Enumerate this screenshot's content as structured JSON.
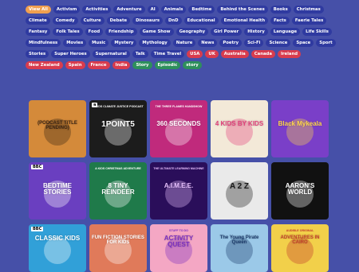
{
  "tags": [
    {
      "label": "View All",
      "style": "active"
    },
    {
      "label": "Activism"
    },
    {
      "label": "Activities"
    },
    {
      "label": "Adventure"
    },
    {
      "label": "AI"
    },
    {
      "label": "Animals"
    },
    {
      "label": "Bedtime"
    },
    {
      "label": "Behind the Scenes"
    },
    {
      "label": "Books"
    },
    {
      "label": "Christmas"
    },
    {
      "label": "Climate"
    },
    {
      "label": "Comedy"
    },
    {
      "label": "Culture"
    },
    {
      "label": "Debate"
    },
    {
      "label": "Dinosaurs"
    },
    {
      "label": "DnD"
    },
    {
      "label": "Educational"
    },
    {
      "label": "Emotional Health"
    },
    {
      "label": "Facts"
    },
    {
      "label": "Faerie Tales"
    },
    {
      "label": "Fantasy"
    },
    {
      "label": "Folk Tales"
    },
    {
      "label": "Food"
    },
    {
      "label": "Friendship"
    },
    {
      "label": "Game Show"
    },
    {
      "label": "Geography"
    },
    {
      "label": "Girl Power"
    },
    {
      "label": "History"
    },
    {
      "label": "Language"
    },
    {
      "label": "Life Skills"
    },
    {
      "label": "Mindfulness"
    },
    {
      "label": "Movies"
    },
    {
      "label": "Music"
    },
    {
      "label": "Mystery"
    },
    {
      "label": "Mythology"
    },
    {
      "label": "Nature"
    },
    {
      "label": "News"
    },
    {
      "label": "Poetry"
    },
    {
      "label": "Sci-Fi"
    },
    {
      "label": "Science"
    },
    {
      "label": "Space"
    },
    {
      "label": "Sport"
    },
    {
      "label": "Stories"
    },
    {
      "label": "Super Heroes"
    },
    {
      "label": "Supernatural"
    },
    {
      "label": "Talk"
    },
    {
      "label": "Time Travel"
    },
    {
      "label": "USA",
      "style": "red"
    },
    {
      "label": "UK",
      "style": "red"
    },
    {
      "label": "Australia",
      "style": "red"
    },
    {
      "label": "Canada",
      "style": "red"
    },
    {
      "label": "Ireland",
      "style": "red"
    },
    {
      "label": "New Zealand",
      "style": "red"
    },
    {
      "label": "Spain",
      "style": "red"
    },
    {
      "label": "France",
      "style": "red"
    },
    {
      "label": "India",
      "style": "red"
    },
    {
      "label": "Story",
      "style": "green"
    },
    {
      "label": "Episodic",
      "style": "green"
    },
    {
      "label": "story",
      "style": "green"
    }
  ],
  "cards": [
    {
      "title": "(PODCAST TITLE PENDING)",
      "bg": "#d48a3a",
      "fg": "#3a2414"
    },
    {
      "title": "1POINT5",
      "sub": "A KIDS CLIMATE JUSTICE PODCAST",
      "bg": "#1c1c1c",
      "fg": "#ffffff",
      "badge": "a"
    },
    {
      "title": "360 SECONDS",
      "sub": "THE THREE FLAMES HANDSHOW",
      "bg": "#c02a7c",
      "fg": "#ffffff"
    },
    {
      "title": "4 KIDS BY KIDS",
      "bg": "#f3e9d8",
      "fg": "#e23f7a"
    },
    {
      "title": "Black Mykeala",
      "bg": "#7a3fc8",
      "fg": "#ffd84a"
    },
    {
      "title": "BEDTIME STORIES",
      "bg": "#6a3fc0",
      "fg": "#ffffff",
      "badge": "BBC"
    },
    {
      "title": "8 TINY REINDEER",
      "sub": "A KIDS CHRISTMAS ADVENTURE",
      "bg": "#1f7a4a",
      "fg": "#ffffff"
    },
    {
      "title": "A.I.M.E.E.",
      "sub": "THE ULTIMATE LEARNING MACHINE",
      "bg": "#2a0e5a",
      "fg": "#e7c0ff"
    },
    {
      "title": "A 2 Z",
      "bg": "#eaeaea",
      "fg": "#1b1b1b"
    },
    {
      "title": "AARON'S WORLD",
      "bg": "#111111",
      "fg": "#ffffff"
    },
    {
      "title": "CLASSIC KIDS",
      "bg": "#31a0d8",
      "fg": "#ffffff",
      "badge": "BBC"
    },
    {
      "title": "FUN FICTION STORIES FOR KIDS",
      "bg": "#e07a5a",
      "fg": "#ffffff"
    },
    {
      "title": "ACTIVITY QUEST",
      "sub": "STUFF TO DO",
      "bg": "#f4a7c4",
      "fg": "#7a2fc0"
    },
    {
      "title": "The Young Pirate Queen",
      "bg": "#9bc9e8",
      "fg": "#1b3a6a"
    },
    {
      "title": "ADVENTURES IN CAIRO",
      "sub": "AUDIBLE ORIGINAL",
      "bg": "#f2d04a",
      "fg": "#c23a2a"
    }
  ]
}
